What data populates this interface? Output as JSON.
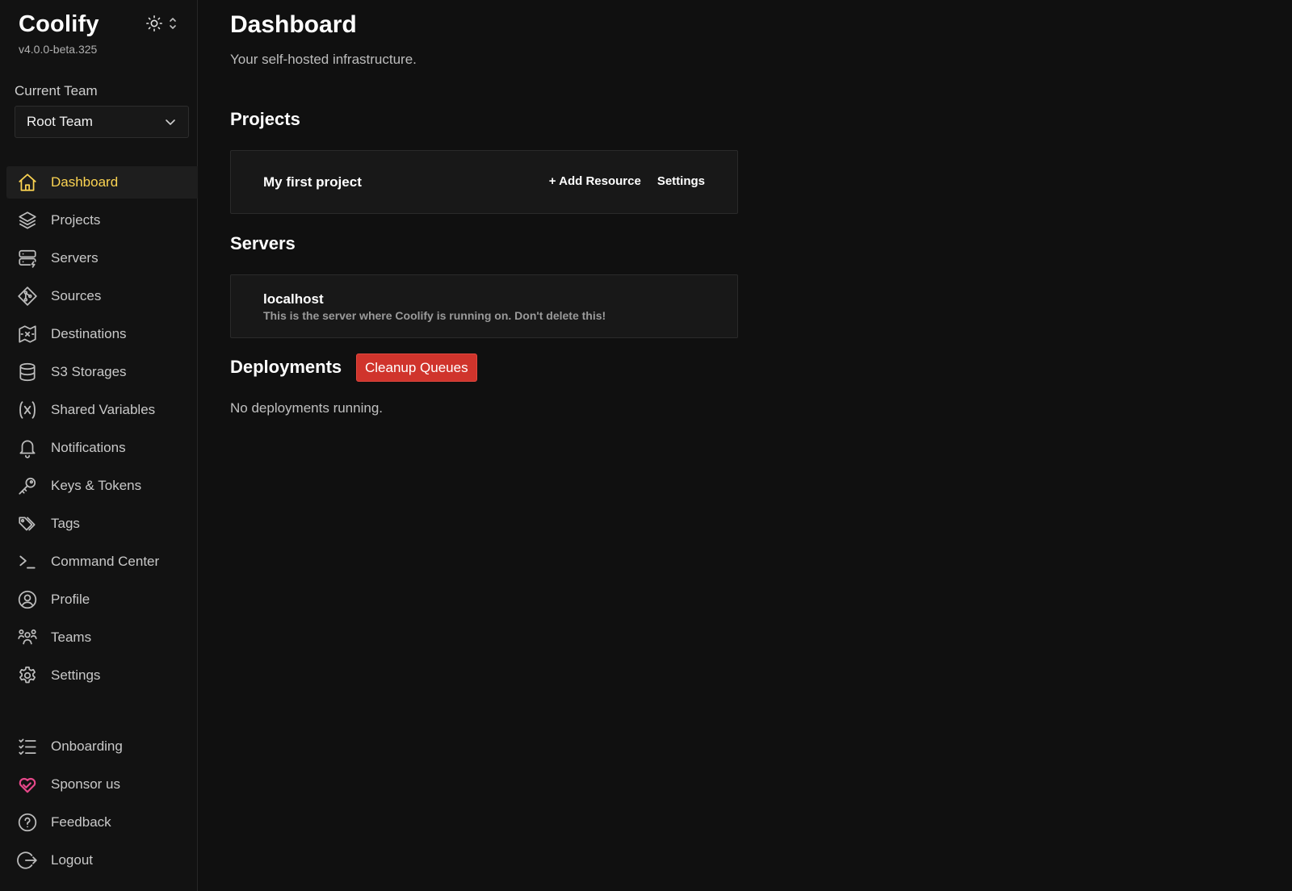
{
  "brand": {
    "name": "Coolify",
    "version": "v4.0.0-beta.325"
  },
  "team": {
    "label": "Current Team",
    "selected": "Root Team"
  },
  "sidebar": {
    "items": [
      {
        "label": "Dashboard",
        "icon": "home-icon",
        "active": true
      },
      {
        "label": "Projects",
        "icon": "layers-icon"
      },
      {
        "label": "Servers",
        "icon": "server-icon"
      },
      {
        "label": "Sources",
        "icon": "git-source-icon"
      },
      {
        "label": "Destinations",
        "icon": "destination-icon"
      },
      {
        "label": "S3 Storages",
        "icon": "database-icon"
      },
      {
        "label": "Shared Variables",
        "icon": "variable-icon"
      },
      {
        "label": "Notifications",
        "icon": "bell-icon"
      },
      {
        "label": "Keys & Tokens",
        "icon": "key-icon"
      },
      {
        "label": "Tags",
        "icon": "tags-icon"
      },
      {
        "label": "Command Center",
        "icon": "terminal-icon"
      },
      {
        "label": "Profile",
        "icon": "user-circle-icon"
      },
      {
        "label": "Teams",
        "icon": "users-icon"
      },
      {
        "label": "Settings",
        "icon": "gear-icon"
      }
    ],
    "bottom_items": [
      {
        "label": "Onboarding",
        "icon": "checklist-icon"
      },
      {
        "label": "Sponsor us",
        "icon": "heart-icon"
      },
      {
        "label": "Feedback",
        "icon": "help-circle-icon"
      },
      {
        "label": "Logout",
        "icon": "logout-icon"
      }
    ]
  },
  "colors": {
    "accent": "#fcd452",
    "danger": "#d0342c",
    "sponsor": "#e7488a",
    "background": "#101010"
  },
  "main": {
    "title": "Dashboard",
    "subtitle": "Your self-hosted infrastructure.",
    "projects": {
      "heading": "Projects",
      "items": [
        {
          "name": "My first project",
          "add_resource": "+ Add Resource",
          "settings": "Settings"
        }
      ]
    },
    "servers": {
      "heading": "Servers",
      "items": [
        {
          "name": "localhost",
          "description": "This is the server where Coolify is running on. Don't delete this!"
        }
      ]
    },
    "deployments": {
      "heading": "Deployments",
      "cleanup_label": "Cleanup Queues",
      "empty_text": "No deployments running."
    }
  }
}
